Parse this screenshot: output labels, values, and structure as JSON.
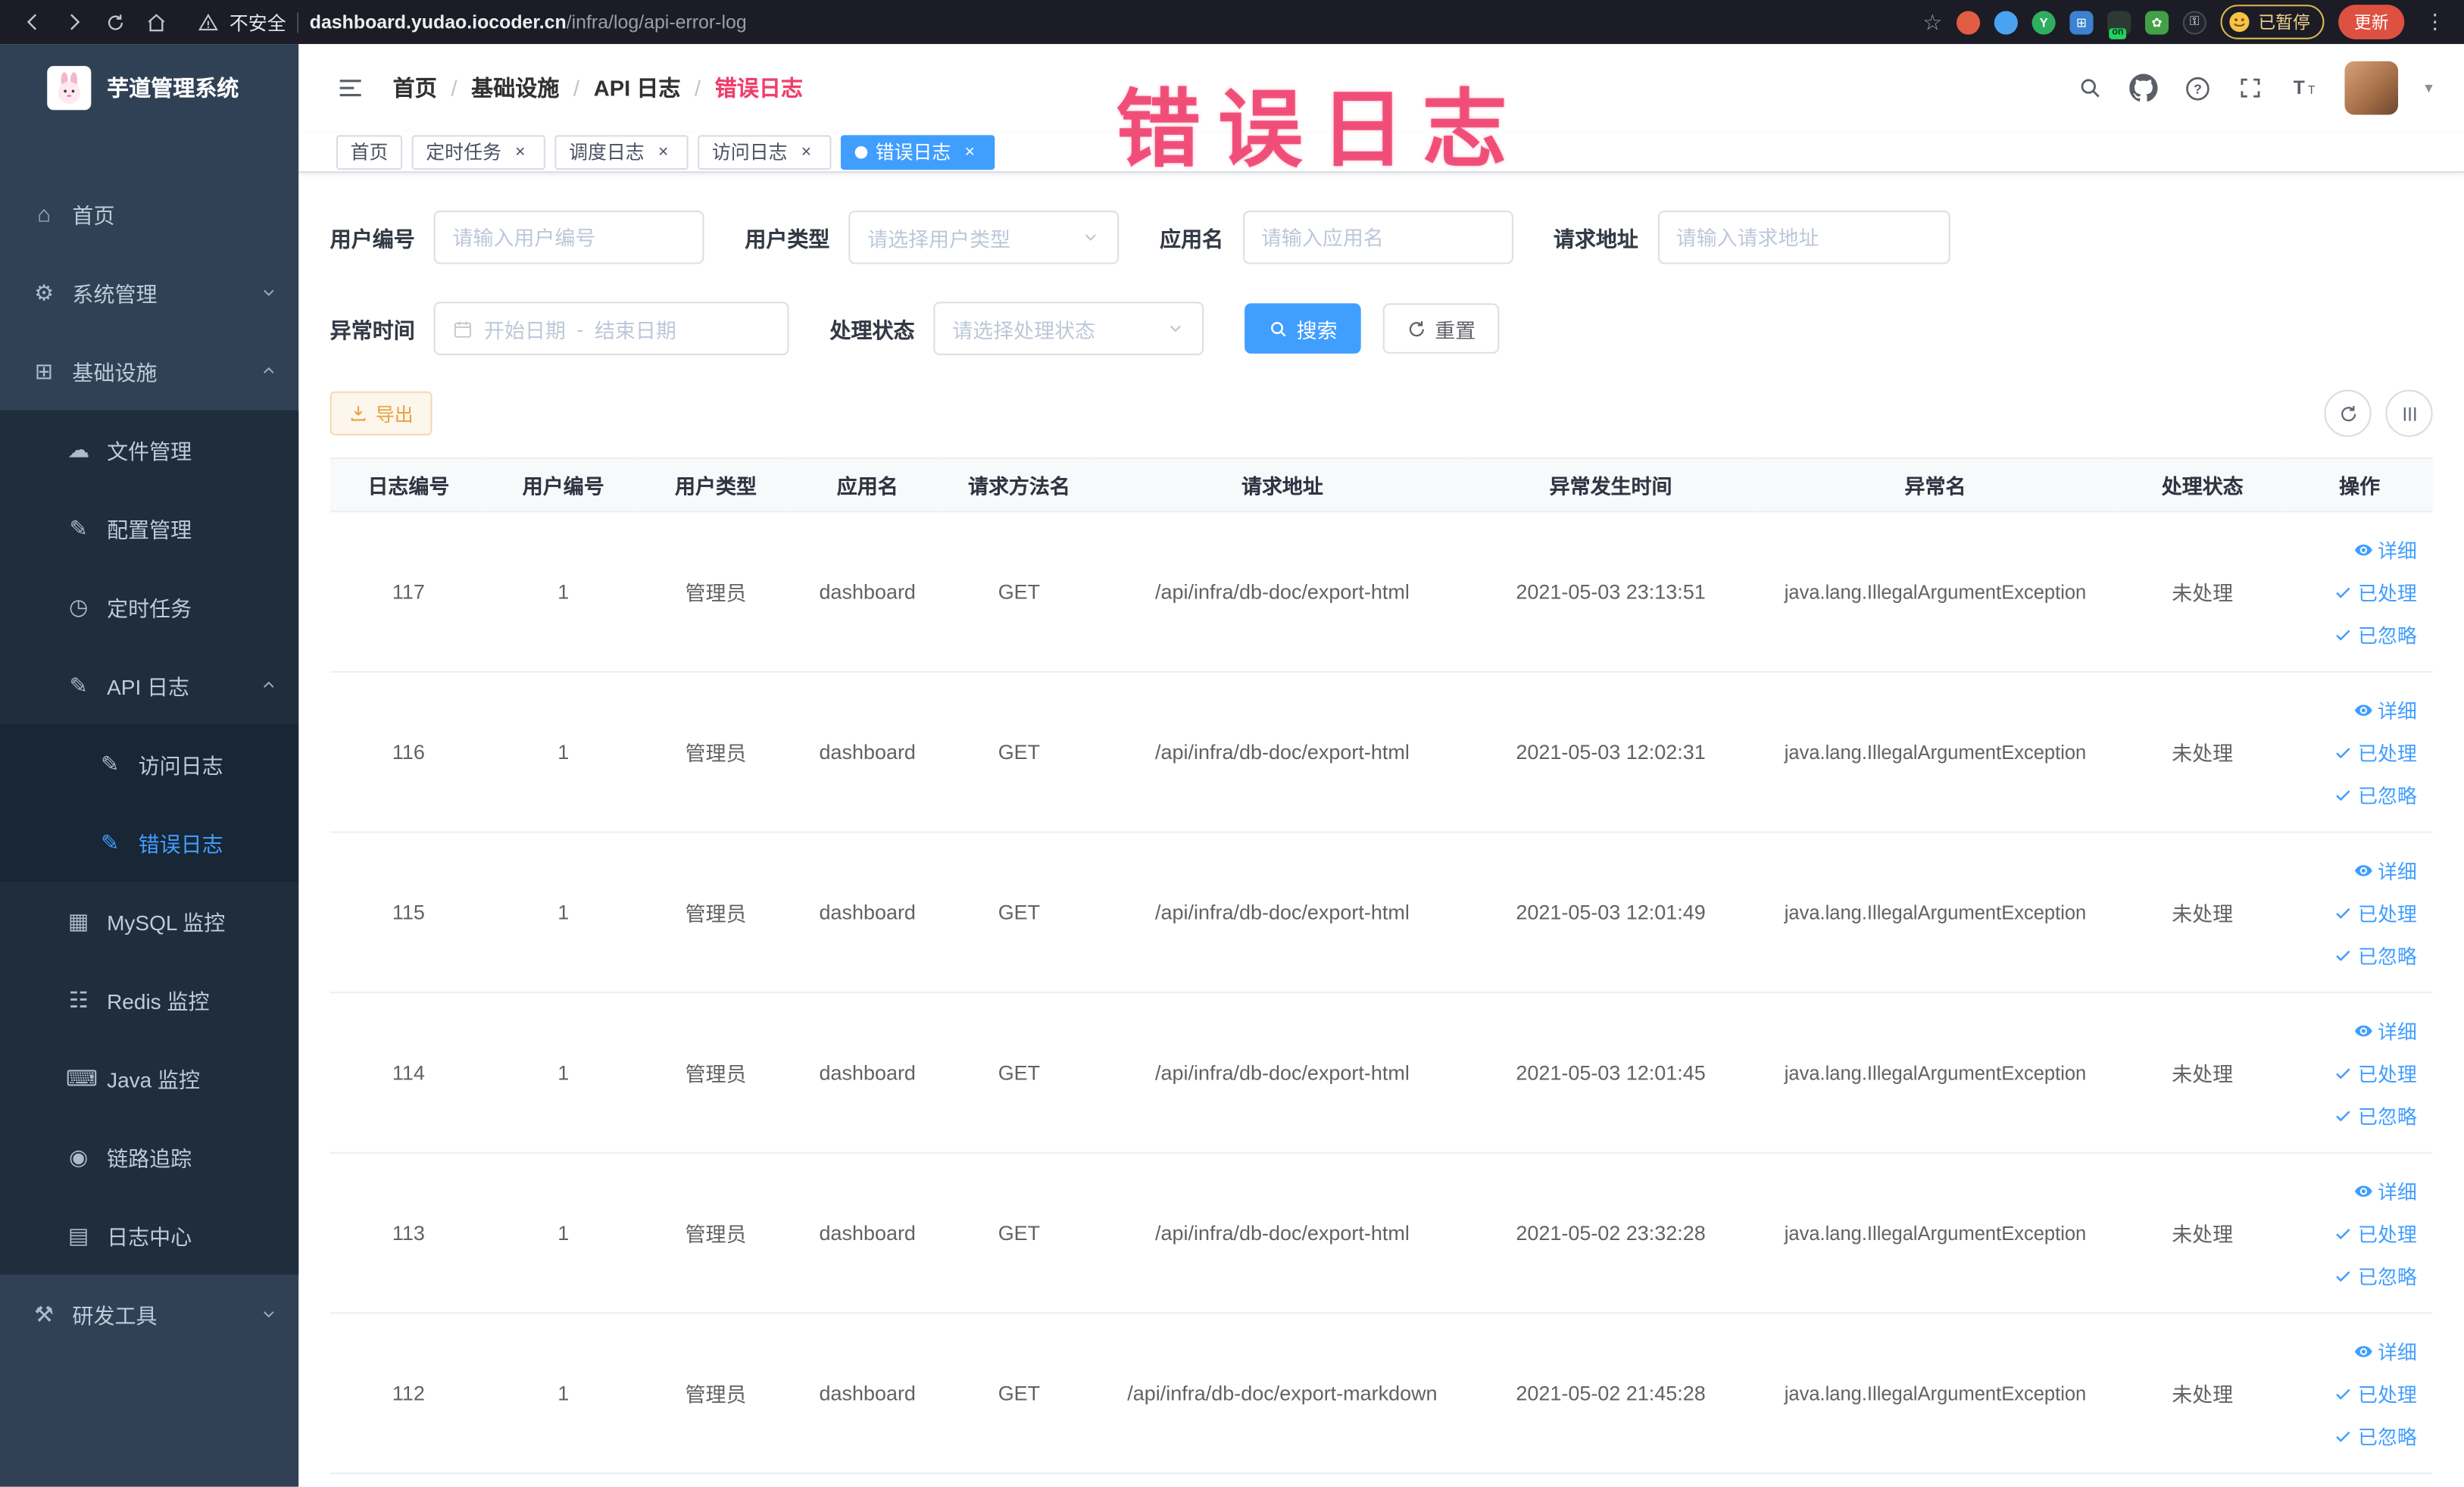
{
  "browser": {
    "security_label": "不安全",
    "url_domain": "dashboard.yudao.iocoder.cn",
    "url_path": "/infra/log/api-error-log",
    "extension_on_badge": "on",
    "paused_badge": "已暂停",
    "update_button": "更新"
  },
  "annotation": {
    "text": "错误日志"
  },
  "sidebar": {
    "logo_title": "芋道管理系统",
    "items": [
      {
        "label": "首页"
      },
      {
        "label": "系统管理"
      },
      {
        "label": "基础设施"
      },
      {
        "label": "文件管理"
      },
      {
        "label": "配置管理"
      },
      {
        "label": "定时任务"
      },
      {
        "label": "API 日志"
      },
      {
        "label": "访问日志"
      },
      {
        "label": "错误日志"
      },
      {
        "label": "MySQL 监控"
      },
      {
        "label": "Redis 监控"
      },
      {
        "label": "Java 监控"
      },
      {
        "label": "链路追踪"
      },
      {
        "label": "日志中心"
      },
      {
        "label": "研发工具"
      }
    ]
  },
  "header": {
    "breadcrumb": [
      {
        "label": "首页"
      },
      {
        "label": "基础设施"
      },
      {
        "label": "API 日志"
      },
      {
        "label": "错误日志"
      }
    ],
    "separator": "/"
  },
  "tabs": {
    "close_glyph": "×",
    "items": [
      {
        "label": "首页"
      },
      {
        "label": "定时任务"
      },
      {
        "label": "调度日志"
      },
      {
        "label": "访问日志"
      },
      {
        "label": "错误日志"
      }
    ]
  },
  "filters": {
    "user_id_label": "用户编号",
    "user_id_placeholder": "请输入用户编号",
    "user_type_label": "用户类型",
    "user_type_placeholder": "请选择用户类型",
    "app_name_label": "应用名",
    "app_name_placeholder": "请输入应用名",
    "request_url_label": "请求地址",
    "request_url_placeholder": "请输入请求地址",
    "exception_time_label": "异常时间",
    "date_start_placeholder": "开始日期",
    "date_separator": "-",
    "date_end_placeholder": "结束日期",
    "status_label": "处理状态",
    "status_placeholder": "请选择处理状态",
    "search_label": "搜索",
    "reset_label": "重置"
  },
  "toolbar": {
    "export_label": "导出"
  },
  "table": {
    "columns": [
      "日志编号",
      "用户编号",
      "用户类型",
      "应用名",
      "请求方法名",
      "请求地址",
      "异常发生时间",
      "异常名",
      "处理状态",
      "操作"
    ],
    "actions": {
      "detail": "详细",
      "processed": "已处理",
      "ignored": "已忽略"
    },
    "rows": [
      {
        "log_id": "117",
        "user_id": "1",
        "user_type": "管理员",
        "app_name": "dashboard",
        "method": "GET",
        "url": "/api/infra/db-doc/export-html",
        "time": "2021-05-03 23:13:51",
        "exception": "java.lang.IllegalArgumentException",
        "status": "未处理"
      },
      {
        "log_id": "116",
        "user_id": "1",
        "user_type": "管理员",
        "app_name": "dashboard",
        "method": "GET",
        "url": "/api/infra/db-doc/export-html",
        "time": "2021-05-03 12:02:31",
        "exception": "java.lang.IllegalArgumentException",
        "status": "未处理"
      },
      {
        "log_id": "115",
        "user_id": "1",
        "user_type": "管理员",
        "app_name": "dashboard",
        "method": "GET",
        "url": "/api/infra/db-doc/export-html",
        "time": "2021-05-03 12:01:49",
        "exception": "java.lang.IllegalArgumentException",
        "status": "未处理"
      },
      {
        "log_id": "114",
        "user_id": "1",
        "user_type": "管理员",
        "app_name": "dashboard",
        "method": "GET",
        "url": "/api/infra/db-doc/export-html",
        "time": "2021-05-03 12:01:45",
        "exception": "java.lang.IllegalArgumentException",
        "status": "未处理"
      },
      {
        "log_id": "113",
        "user_id": "1",
        "user_type": "管理员",
        "app_name": "dashboard",
        "method": "GET",
        "url": "/api/infra/db-doc/export-html",
        "time": "2021-05-02 23:32:28",
        "exception": "java.lang.IllegalArgumentException",
        "status": "未处理"
      },
      {
        "log_id": "112",
        "user_id": "1",
        "user_type": "管理员",
        "app_name": "dashboard",
        "method": "GET",
        "url": "/api/infra/db-doc/export-markdown",
        "time": "2021-05-02 21:45:28",
        "exception": "java.lang.IllegalArgumentException",
        "status": "未处理"
      }
    ]
  }
}
